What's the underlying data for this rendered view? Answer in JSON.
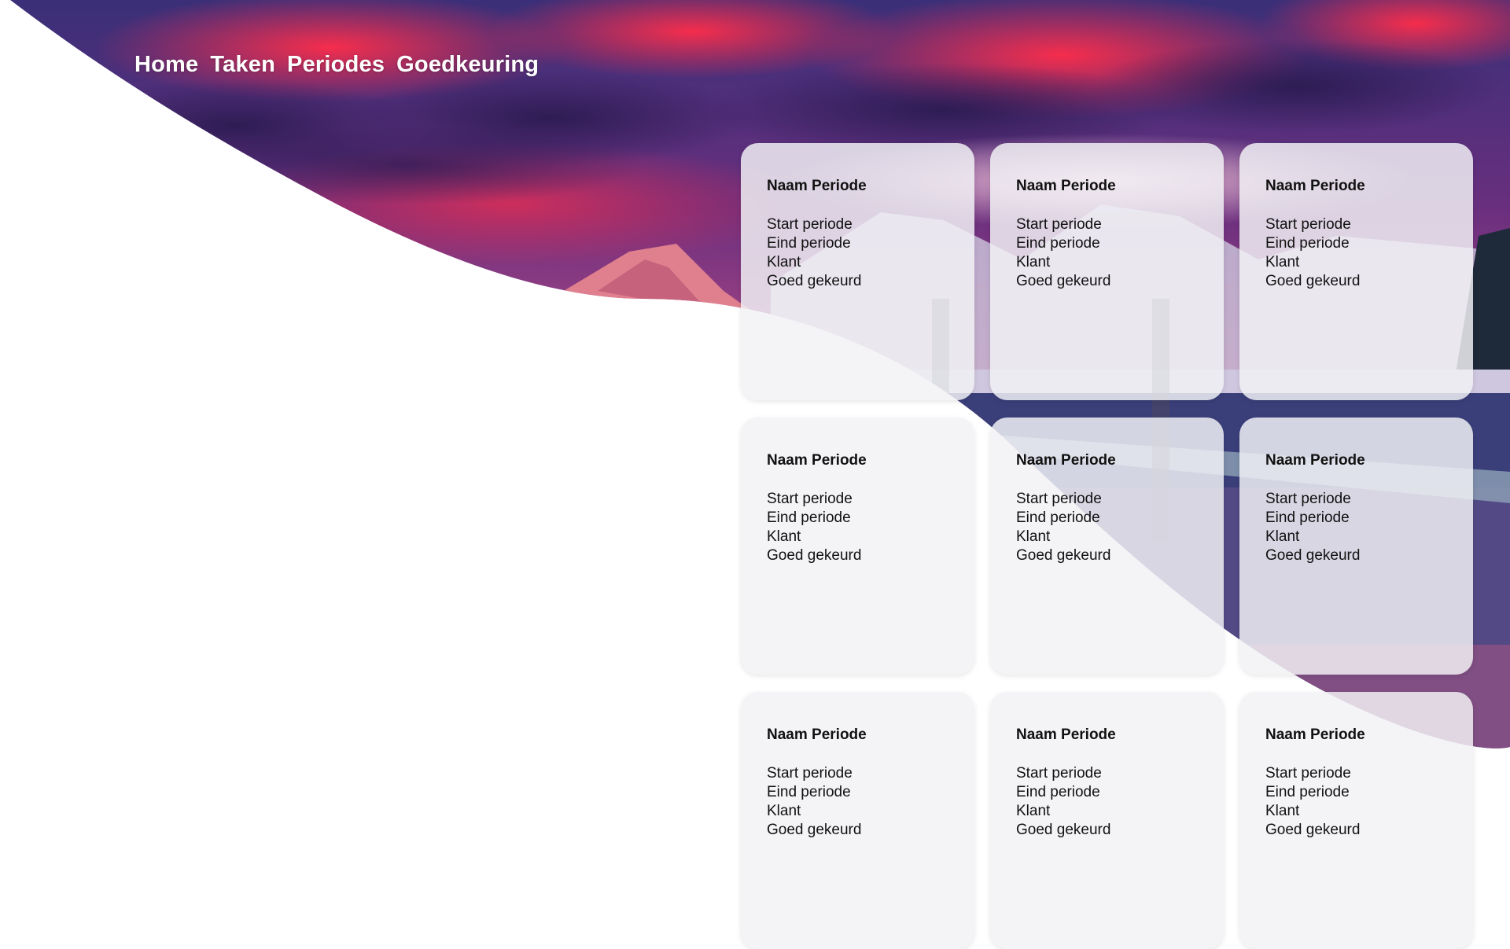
{
  "nav": {
    "items": [
      {
        "label": "Home"
      },
      {
        "label": "Taken"
      },
      {
        "label": "Periodes"
      },
      {
        "label": "Goedkeuring"
      }
    ]
  },
  "cards": [
    {
      "title": "Naam Periode",
      "start": "Start periode",
      "end": "Eind periode",
      "client": "Klant",
      "approved": "Goed gekeurd"
    },
    {
      "title": "Naam Periode",
      "start": "Start periode",
      "end": "Eind periode",
      "client": "Klant",
      "approved": "Goed gekeurd"
    },
    {
      "title": "Naam Periode",
      "start": "Start periode",
      "end": "Eind periode",
      "client": "Klant",
      "approved": "Goed gekeurd"
    },
    {
      "title": "Naam Periode",
      "start": "Start periode",
      "end": "Eind periode",
      "client": "Klant",
      "approved": "Goed gekeurd"
    },
    {
      "title": "Naam Periode",
      "start": "Start periode",
      "end": "Eind periode",
      "client": "Klant",
      "approved": "Goed gekeurd"
    },
    {
      "title": "Naam Periode",
      "start": "Start periode",
      "end": "Eind periode",
      "client": "Klant",
      "approved": "Goed gekeurd"
    },
    {
      "title": "Naam Periode",
      "start": "Start periode",
      "end": "Eind periode",
      "client": "Klant",
      "approved": "Goed gekeurd"
    },
    {
      "title": "Naam Periode",
      "start": "Start periode",
      "end": "Eind periode",
      "client": "Klant",
      "approved": "Goed gekeurd"
    },
    {
      "title": "Naam Periode",
      "start": "Start periode",
      "end": "Eind periode",
      "client": "Klant",
      "approved": "Goed gekeurd"
    }
  ],
  "colors": {
    "sky_top": "#2a2f6e",
    "cloud_red": "#e8304a",
    "cloud_purple": "#5b2a78",
    "mountain_pink": "#f07a8a",
    "lake": "#3a3f7a",
    "card_bg": "#f2f2f6"
  }
}
